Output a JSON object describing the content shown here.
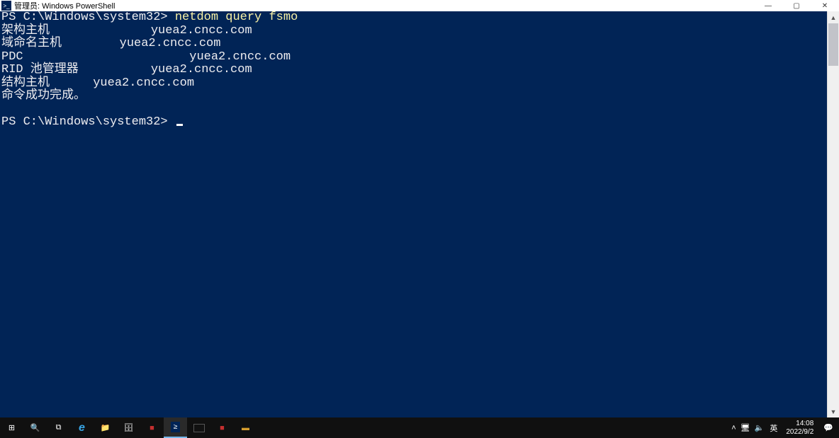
{
  "window": {
    "title": "管理员: Windows PowerShell",
    "icon": "powershell-icon",
    "controls": {
      "min": "—",
      "max": "▢",
      "close": "✕"
    }
  },
  "console": {
    "prompt1_prefix": "PS C:\\Windows\\system32> ",
    "command": "netdom query fsmo",
    "output": "架构主机              yuea2.cncc.com\n域命名主机        yuea2.cncc.com\nPDC                       yuea2.cncc.com\nRID 池管理器          yuea2.cncc.com\n结构主机      yuea2.cncc.com\n命令成功完成。\n",
    "prompt2": "PS C:\\Windows\\system32> "
  },
  "taskbar": {
    "items": [
      {
        "name": "start",
        "glyph": "⊞"
      },
      {
        "name": "search",
        "glyph": "🔍"
      },
      {
        "name": "task-view",
        "glyph": "⧉"
      },
      {
        "name": "ie",
        "glyph": "e"
      },
      {
        "name": "explorer",
        "glyph": "📁"
      },
      {
        "name": "server-manager",
        "glyph": "🗄"
      },
      {
        "name": "app1",
        "glyph": "■"
      },
      {
        "name": "powershell",
        "glyph": "≥",
        "active": true
      },
      {
        "name": "cmd",
        "glyph": "▭"
      },
      {
        "name": "app2",
        "glyph": "■"
      },
      {
        "name": "app3",
        "glyph": "▬"
      }
    ],
    "tray": {
      "chevron": "˄",
      "net": "🖥",
      "vol": "🔈",
      "ime": "英"
    },
    "clock_time": "14:08",
    "clock_date": "2022/9/2"
  }
}
